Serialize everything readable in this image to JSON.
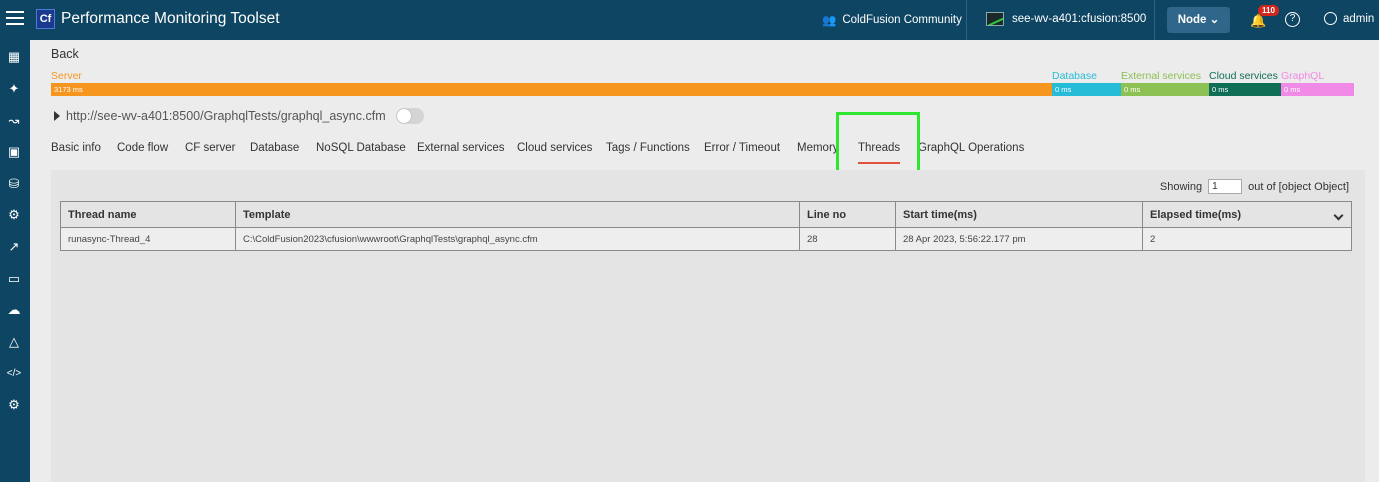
{
  "header": {
    "app_title": "Performance Monitoring Toolset",
    "logo_text": "Cf",
    "community": "ColdFusion Community",
    "server": "see-wv-a401:cfusion:8500",
    "node_label": "Node",
    "notification_count": "110",
    "help_glyph": "?",
    "user": "admin"
  },
  "sidebar": {
    "icons": [
      "dashboard-icon",
      "topology-icon",
      "graph-icon",
      "cf-server-icon",
      "database-icon",
      "db-settings-icon",
      "export-icon",
      "tablet-icon",
      "cloud-icon",
      "network-icon",
      "code-icon",
      "settings-icon"
    ]
  },
  "page": {
    "back": "Back",
    "url": "http://see-wv-a401:8500/GraphqlTests/graphql_async.cfm"
  },
  "breakdown": {
    "server_label": "Server",
    "server_value": "3173 ms",
    "database_label": "Database",
    "database_value": "0 ms",
    "external_label": "External services",
    "external_value": "0 ms",
    "cloud_label": "Cloud services",
    "cloud_value": "0 ms",
    "graphql_label": "GraphQL",
    "graphql_value": "0 ms",
    "colors": {
      "server": "#f7961e",
      "database": "#26bcd7",
      "external": "#8dc153",
      "cloud": "#0f6e55",
      "graphql": "#f08ae6"
    }
  },
  "tabs": {
    "basic_info": "Basic info",
    "code_flow": "Code flow",
    "cf_server": "CF server",
    "database": "Database",
    "nosql": "NoSQL Database",
    "external": "External services",
    "cloud": "Cloud services",
    "tags": "Tags / Functions",
    "error": "Error / Timeout",
    "memory": "Memory",
    "threads": "Threads",
    "graphql": "GraphQL Operations",
    "active": "Threads"
  },
  "pagination": {
    "showing": "Showing",
    "page": "1",
    "out_of": "out of [object Object]"
  },
  "table": {
    "headers": [
      "Thread name",
      "Template",
      "Line no",
      "Start time(ms)",
      "Elapsed time(ms)"
    ],
    "rows": [
      [
        "runasync-Thread_4",
        "C:\\ColdFusion2023\\cfusion\\wwwroot\\GraphqlTests\\graphql_async.cfm",
        "28",
        "28 Apr 2023, 5:56:22.177 pm",
        "2"
      ]
    ]
  }
}
